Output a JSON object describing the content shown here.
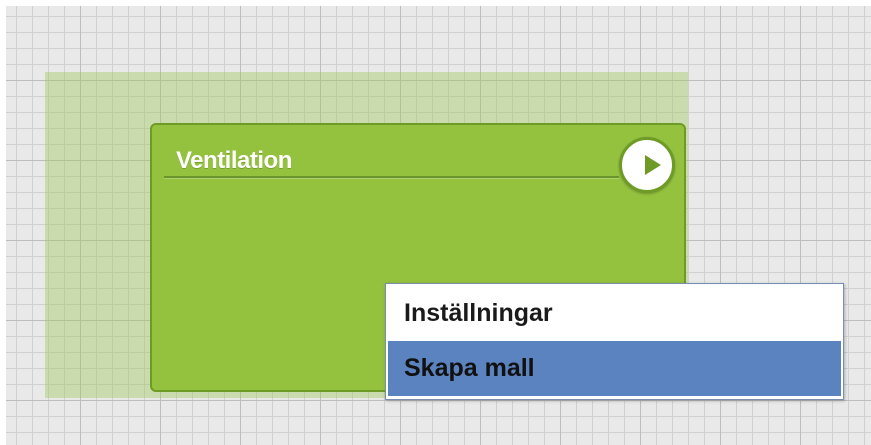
{
  "node": {
    "title": "Ventilation",
    "play_icon": "play-icon"
  },
  "context_menu": {
    "items": [
      {
        "label": "Inställningar",
        "selected": false
      },
      {
        "label": "Skapa mall",
        "selected": true
      }
    ]
  },
  "colors": {
    "node_fill": "#94c13e",
    "node_border": "#6e9a26",
    "selection_highlight": "#5b83c0",
    "canvas_background": "#e9e9e9"
  }
}
